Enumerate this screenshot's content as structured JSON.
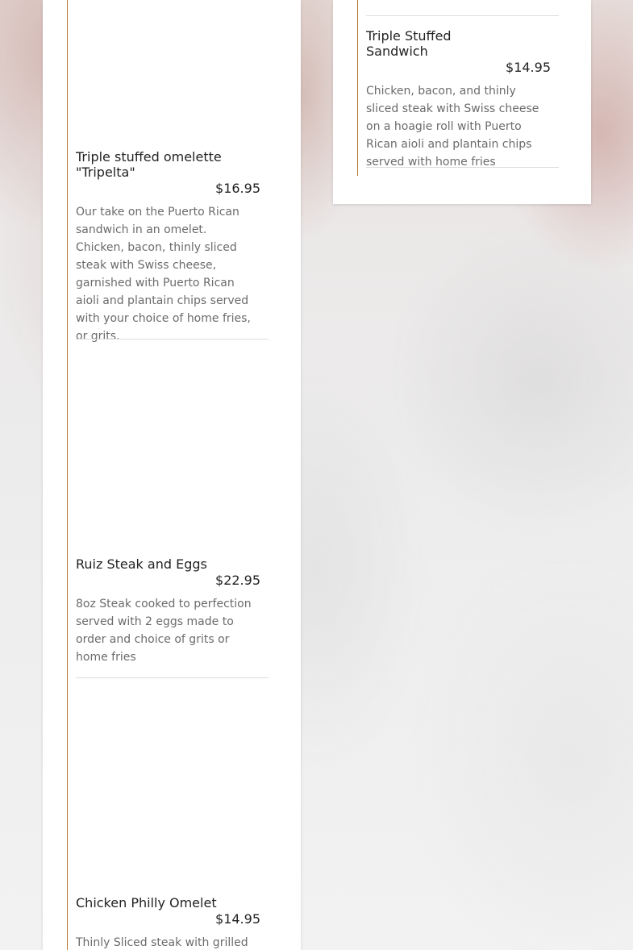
{
  "colors": {
    "accent_rail": "#b57a2e",
    "title_text": "#222222",
    "description_text": "#6b6b6b",
    "card_background": "#ffffff"
  },
  "left_column": {
    "items": [
      {
        "title": "Triple stuffed omelette \"Tripelta\"",
        "price": "$16.95",
        "description": "Our take on the Puerto Rican sandwich in an omelet. Chicken, bacon, thinly sliced steak with Swiss cheese, garnished with Puerto Rican aioli and plantain chips served with your choice of home fries, or grits."
      },
      {
        "title": "Ruiz Steak and Eggs",
        "price": "$22.95",
        "description": "8oz Steak cooked to perfection served with 2 eggs made to order and choice of grits or home fries"
      },
      {
        "title": "Chicken Philly Omelet",
        "price": "$14.95",
        "description": "Thinly Sliced steak with grilled"
      }
    ]
  },
  "right_column": {
    "items": [
      {
        "title": "Triple Stuffed Sandwich",
        "price": "$14.95",
        "description": "Chicken, bacon, and thinly sliced steak with Swiss cheese on a hoagie roll with Puerto Rican aioli and plantain chips served with home fries"
      }
    ]
  }
}
